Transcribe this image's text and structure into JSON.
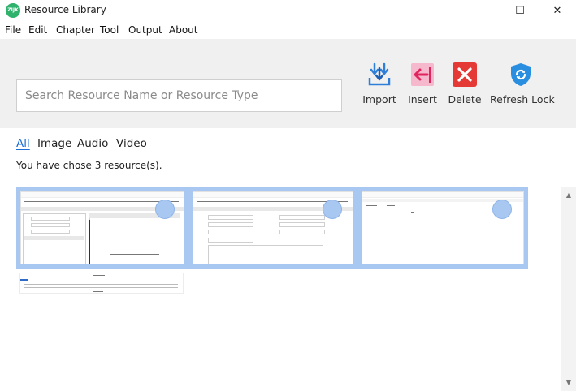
{
  "window": {
    "title": "Resource Library",
    "app_icon_text": "ZIJK",
    "minimize_glyph": "—",
    "maximize_glyph": "☐",
    "close_glyph": "✕"
  },
  "menu": [
    "File",
    "Edit",
    "Chapter",
    "Tool",
    "Output",
    "About"
  ],
  "search": {
    "placeholder": "Search Resource Name or Resource Type",
    "value": ""
  },
  "toolbar": {
    "import_label": "Import",
    "insert_label": "Insert",
    "delete_label": "Delete",
    "refresh_lock_label": "Refresh Lock"
  },
  "tabs": [
    "All",
    "Image",
    "Audio",
    "Video"
  ],
  "active_tab": "All",
  "status_text": "You have chose 3 resource(s).",
  "resources": [
    {
      "selected": true
    },
    {
      "selected": true
    },
    {
      "selected": true
    },
    {
      "selected": false
    }
  ],
  "colors": {
    "accent": "#1a6fd6",
    "selection": "#a8c8f2",
    "import_icon": "#2f7fd8",
    "insert_icon_bg": "#f6b8cc",
    "insert_icon_fg": "#e0245e",
    "delete_icon": "#e53935",
    "refresh_icon": "#2a8ee0"
  },
  "scrollbar": {
    "up_glyph": "▲",
    "down_glyph": "▼"
  }
}
